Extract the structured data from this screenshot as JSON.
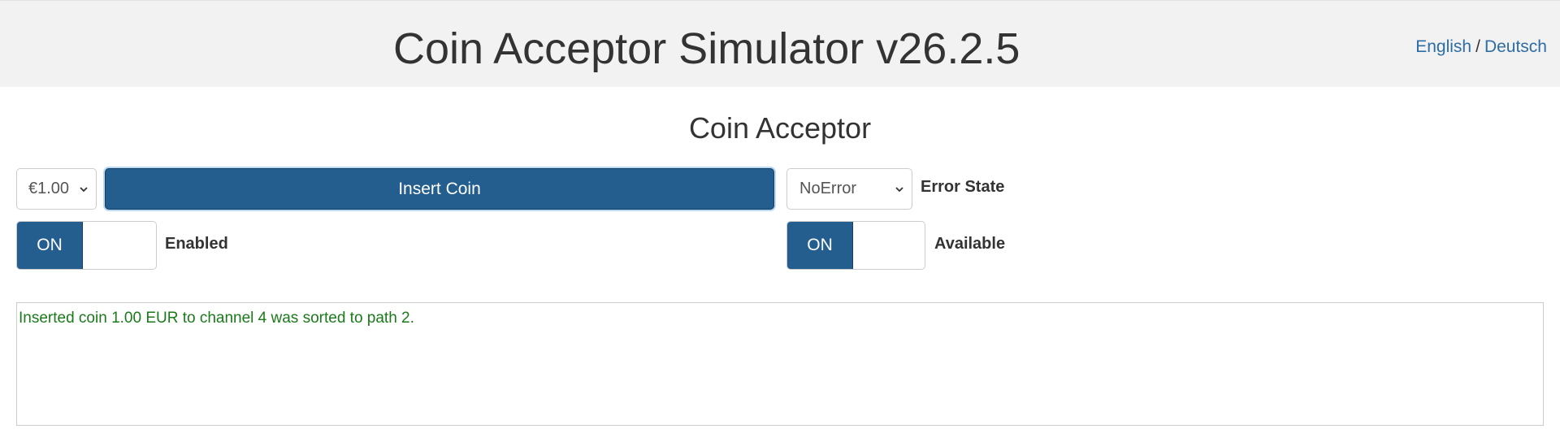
{
  "header": {
    "title": "Coin Acceptor Simulator v26.2.5",
    "lang_english": "English",
    "lang_separator": "/",
    "lang_deutsch": "Deutsch"
  },
  "section": {
    "title": "Coin Acceptor"
  },
  "controls": {
    "coin_value": "€1.00",
    "insert_label": "Insert Coin",
    "error_state_value": "NoError",
    "error_state_label": "Error State",
    "enabled_toggle": "ON",
    "enabled_label": "Enabled",
    "available_toggle": "ON",
    "available_label": "Available"
  },
  "log": {
    "lines": [
      "Inserted coin 1.00 EUR to channel 4 was sorted to path 2."
    ]
  },
  "colors": {
    "primary": "#245e8f",
    "link": "#2e6da4",
    "log_text": "#1a7a1a",
    "header_bg": "#f2f2f2"
  }
}
